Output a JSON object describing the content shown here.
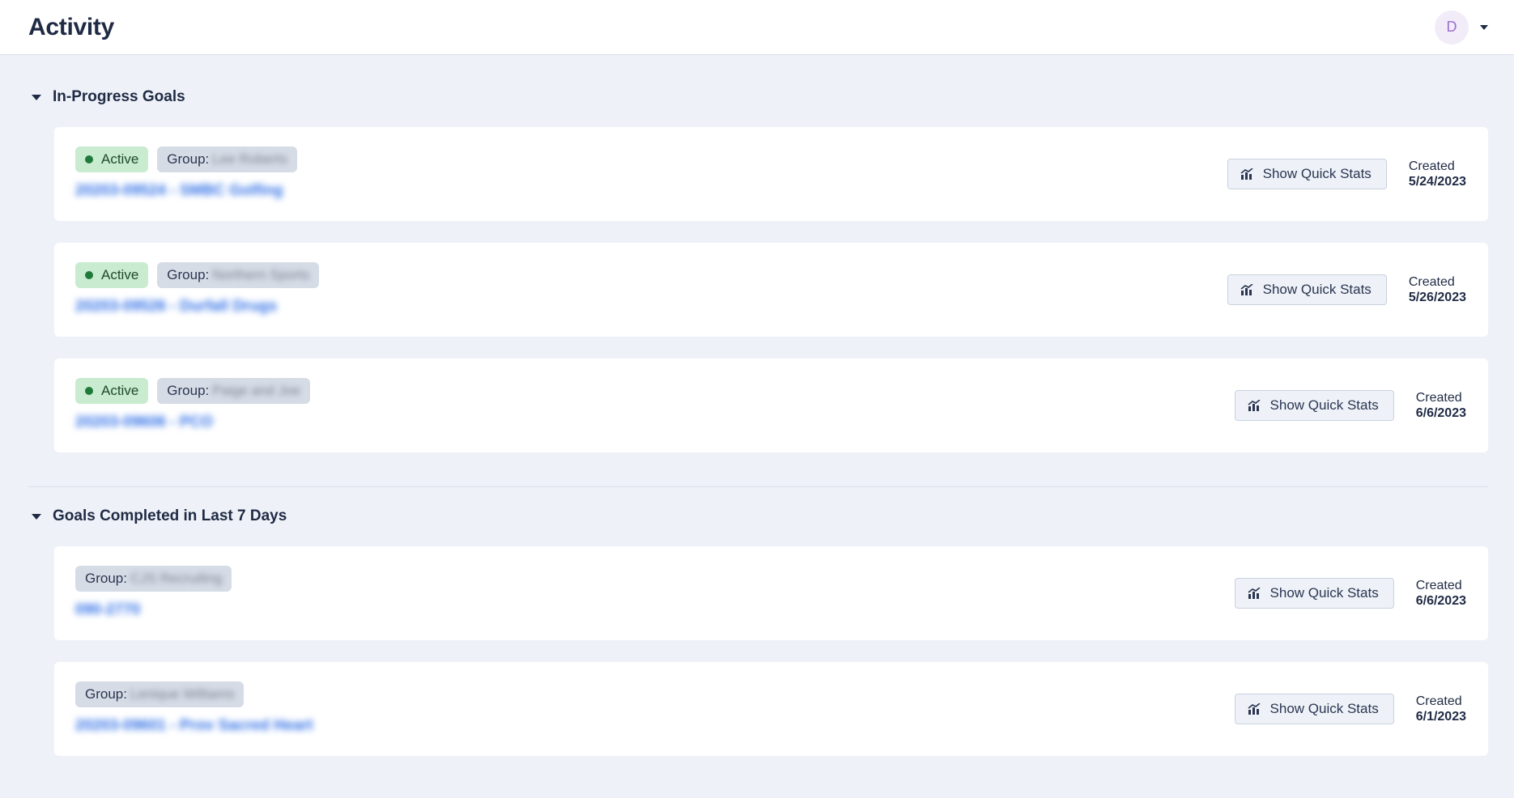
{
  "header": {
    "title": "Activity",
    "avatar_initial": "D"
  },
  "sections": [
    {
      "title": "In-Progress Goals",
      "cards": [
        {
          "status": "Active",
          "group_label": "Group:",
          "group_name": "Lee Roberts",
          "goal": "20203-09524 - SMBC Golfing",
          "button": "Show Quick Stats",
          "created_label": "Created",
          "created_date": "5/24/2023"
        },
        {
          "status": "Active",
          "group_label": "Group:",
          "group_name": "Northern Sports",
          "goal": "20203-09526 - Durfall Drugs",
          "button": "Show Quick Stats",
          "created_label": "Created",
          "created_date": "5/26/2023"
        },
        {
          "status": "Active",
          "group_label": "Group:",
          "group_name": "Paige and Joe",
          "goal": "20203-09606 - PCO",
          "button": "Show Quick Stats",
          "created_label": "Created",
          "created_date": "6/6/2023"
        }
      ]
    },
    {
      "title": "Goals Completed in Last 7 Days",
      "cards": [
        {
          "group_label": "Group:",
          "group_name": "CJS Recruiting",
          "goal": "090-2770",
          "button": "Show Quick Stats",
          "created_label": "Created",
          "created_date": "6/6/2023"
        },
        {
          "group_label": "Group:",
          "group_name": "Lenique Williams",
          "goal": "20203-09601 - Prov Sacred Heart",
          "button": "Show Quick Stats",
          "created_label": "Created",
          "created_date": "6/1/2023"
        }
      ]
    }
  ],
  "icons": {
    "chart": "bar-chart-icon",
    "collapse": "caret-down-icon"
  }
}
